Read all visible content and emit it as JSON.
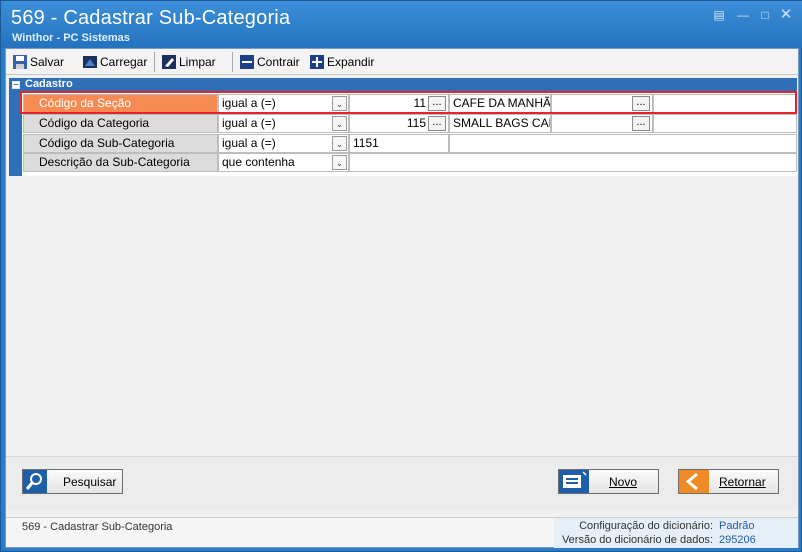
{
  "window": {
    "title": "569 - Cadastrar Sub-Categoria",
    "subtitle": "Winthor - PC Sistemas",
    "accent": "#2b7cc6"
  },
  "toolbar": {
    "save_label": "Salvar",
    "load_label": "Carregar",
    "clear_label": "Limpar",
    "collapse_label": "Contrair",
    "expand_label": "Expandir"
  },
  "form": {
    "section_title": "Cadastro",
    "highlight_color": "#e2242b",
    "rows": [
      {
        "label": "Código da Seção",
        "operator": "igual a (=)",
        "value": "11",
        "description": "CAFE DA MANHÃ"
      },
      {
        "label": "Código da Categoria",
        "operator": "igual a (=)",
        "value": "115",
        "description": "SMALL BAGS CANINI"
      },
      {
        "label": "Código da Sub-Categoria",
        "operator": "igual a (=)",
        "value": "1151"
      },
      {
        "label": "Descrição da Sub-Categoria",
        "operator": "que contenha",
        "value": ""
      }
    ],
    "ellipsis": "..."
  },
  "buttons": {
    "search_label": "Pesquisar",
    "new_label": "Novo",
    "return_label": "Retornar"
  },
  "status": {
    "screen_name": "569 - Cadastrar Sub-Categoria",
    "dict_config_label": "Configuração do dicionário:",
    "dict_config_value": "Padrão",
    "dict_version_label": "Versão do dicionário de dados:",
    "dict_version_value": "295206"
  }
}
